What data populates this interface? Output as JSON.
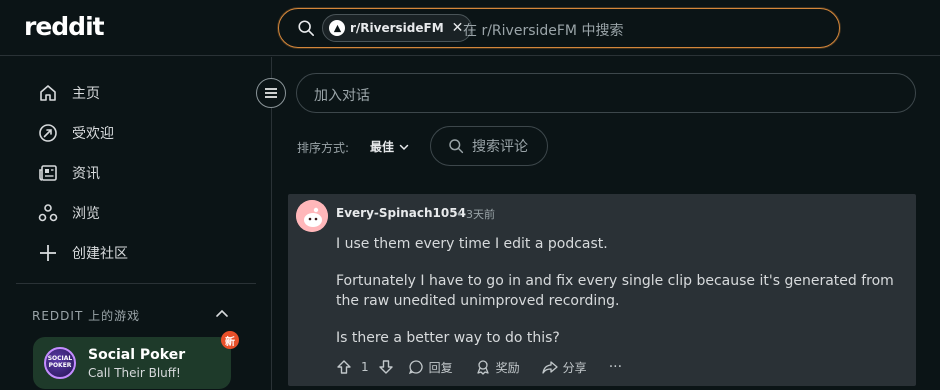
{
  "header": {
    "logo": "reddit",
    "search_chip": "r/RiversideFM",
    "search_placeholder": "在 r/RiversideFM 中搜索"
  },
  "sidebar": {
    "items": [
      {
        "label": "主页",
        "icon": "home-icon"
      },
      {
        "label": "受欢迎",
        "icon": "popular-icon"
      },
      {
        "label": "资讯",
        "icon": "news-icon"
      },
      {
        "label": "浏览",
        "icon": "explore-icon"
      },
      {
        "label": "创建社区",
        "icon": "plus-icon"
      }
    ],
    "section_title": "REDDIT 上的游戏",
    "game": {
      "title": "Social Poker",
      "subtitle": "Call Their Bluff!",
      "badge": "新",
      "avatar_text": "SOCIAL POKER"
    }
  },
  "main": {
    "conversation_placeholder": "加入对话",
    "sort_label": "排序方式:",
    "sort_value": "最佳",
    "search_comments": "搜索评论"
  },
  "comment": {
    "author": "Every-Spinach1054",
    "time": "• 3天前",
    "paragraphs": [
      "I use them every time I edit a podcast.",
      "Fortunately I have to go in and fix every single clip because it's generated from the raw unedited unimproved recording.",
      "Is there a better way to do this?"
    ],
    "votes": "1",
    "reply": "回复",
    "award": "奖励",
    "share": "分享",
    "more": "···"
  },
  "colors": {
    "background": "#0b1416",
    "search_border": "#d4863a",
    "comment_bg": "#2a3136",
    "game_card": "#1e3a2a",
    "badge": "#e8502a"
  }
}
